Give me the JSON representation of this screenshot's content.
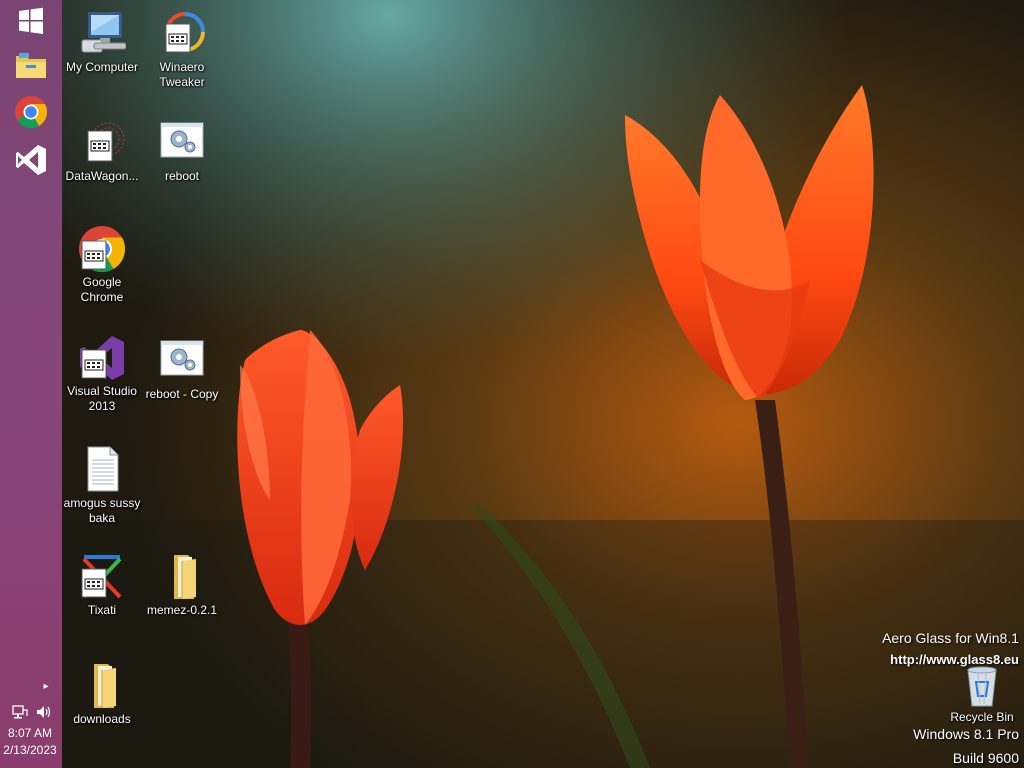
{
  "desktop": {
    "icons": [
      {
        "label": "My Computer"
      },
      {
        "label": "Winaero Tweaker"
      },
      {
        "label": "DataWagon..."
      },
      {
        "label": "reboot"
      },
      {
        "label": "Google Chrome"
      },
      {
        "label": "Visual Studio 2013"
      },
      {
        "label": "reboot - Copy"
      },
      {
        "label": "amogus sussy baka"
      },
      {
        "label": "Tixati"
      },
      {
        "label": "memez-0.2.1"
      },
      {
        "label": "downloads"
      },
      {
        "label": "Recycle Bin"
      }
    ]
  },
  "taskbar": {
    "buttons": [
      "start-icon",
      "file-explorer-icon",
      "chrome-icon",
      "visual-studio-icon"
    ],
    "tray": {
      "time": "8:07 AM",
      "date": "2/13/2023"
    }
  },
  "watermark": {
    "line1": "Aero Glass for Win8.1",
    "line2": "http://www.glass8.eu",
    "edition": "Windows 8.1 Pro",
    "build": "Build 9600"
  },
  "colors": {
    "taskbar": "#86467a",
    "tulip": "#ff4a1a"
  }
}
